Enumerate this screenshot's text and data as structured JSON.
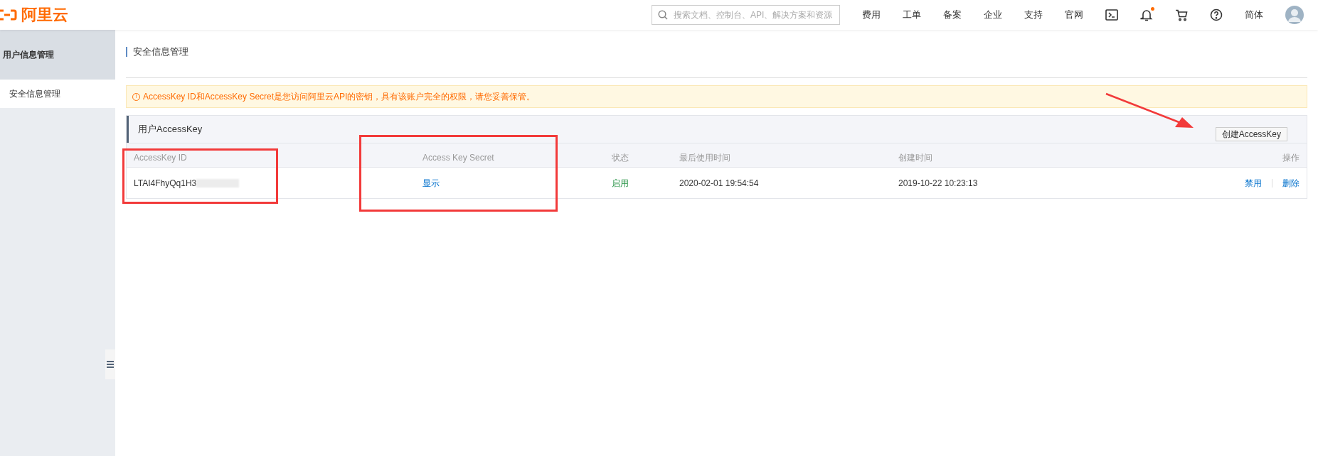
{
  "header": {
    "logo_text": "阿里云",
    "search": {
      "placeholder": "搜索文档、控制台、API、解决方案和资源"
    },
    "nav": [
      {
        "kind": "text",
        "label": "费用"
      },
      {
        "kind": "text",
        "label": "工单"
      },
      {
        "kind": "text",
        "label": "备案"
      },
      {
        "kind": "text",
        "label": "企业"
      },
      {
        "kind": "text",
        "label": "支持"
      },
      {
        "kind": "text",
        "label": "官网"
      },
      {
        "kind": "terminal"
      },
      {
        "kind": "bell",
        "badge": true
      },
      {
        "kind": "cart"
      },
      {
        "kind": "help"
      },
      {
        "kind": "text",
        "label": "简体"
      },
      {
        "kind": "avatar"
      }
    ]
  },
  "sidebar": {
    "title": "用户信息管理",
    "items": [
      {
        "label": "安全信息管理",
        "selected": true
      }
    ]
  },
  "page_title": "安全信息管理",
  "alert": {
    "icon": "!",
    "text": "AccessKey ID和AccessKey Secret是您访问阿里云API的密钥，具有该账户完全的权限，请您妥善保管。"
  },
  "panel": {
    "title": "用户AccessKey",
    "create_button": "创建AccessKey"
  },
  "table": {
    "columns": [
      "AccessKey ID",
      "Access Key Secret",
      "状态",
      "最后使用时间",
      "创建时间",
      "操作"
    ],
    "rows": [
      {
        "id": "LTAI4FhyQq1H3",
        "id_redacted": true,
        "secret": "显示",
        "status": "启用",
        "enabled": true,
        "last_used": "2020-02-01 19:54:54",
        "created": "2019-10-22 10:23:13",
        "actions": [
          "禁用",
          "删除"
        ]
      }
    ]
  },
  "annotations": {
    "id_column_box": true,
    "secret_column_box": true,
    "arrow": true
  }
}
